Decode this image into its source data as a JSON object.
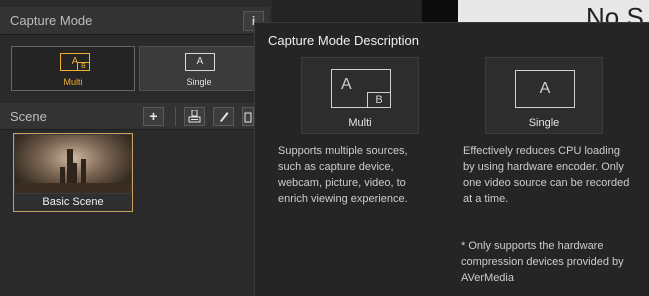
{
  "capture_panel": {
    "title": "Capture Mode",
    "info_label": "i",
    "modes": [
      {
        "icon_main": "A",
        "icon_sub": "B",
        "label": "Multi"
      },
      {
        "icon_main": "A",
        "label": "Single"
      }
    ]
  },
  "scene_panel": {
    "title": "Scene",
    "add_label": "+",
    "scenes": [
      {
        "name": "Basic Scene"
      }
    ]
  },
  "preview": {
    "text": "No S"
  },
  "popup": {
    "title": "Capture Mode Description",
    "cards": [
      {
        "icon_main": "A",
        "icon_sub": "B",
        "label": "Multi",
        "description": "Supports multiple sources, such as capture device, webcam, picture, video, to enrich viewing experience."
      },
      {
        "icon_main": "A",
        "label": "Single",
        "description": "Effectively reduces CPU loading by using hardware encoder. Only one video source can be recorded at a time."
      }
    ],
    "footnote": "* Only supports the hardware compression devices provided by AVerMedia"
  },
  "colors": {
    "accent": "#f0b030",
    "panel": "#2a2a2a",
    "popup": "#252525"
  }
}
